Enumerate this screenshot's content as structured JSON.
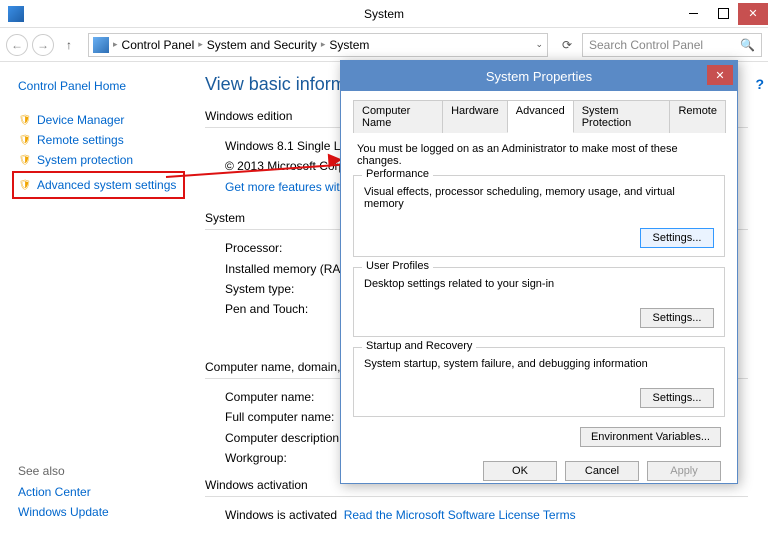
{
  "window": {
    "title": "System"
  },
  "breadcrumb": {
    "root": "Control Panel",
    "mid": "System and Security",
    "leaf": "System"
  },
  "search": {
    "placeholder": "Search Control Panel"
  },
  "sidebar": {
    "home": "Control Panel Home",
    "items": [
      "Device Manager",
      "Remote settings",
      "System protection",
      "Advanced system settings"
    ],
    "seeAlso": "See also",
    "alsoItems": [
      "Action Center",
      "Windows Update"
    ]
  },
  "page": {
    "heading": "View basic information about your computer",
    "ed_hdr": "Windows edition",
    "ed_line1": "Windows 8.1 Single Language",
    "ed_line2": "© 2013 Microsoft Corporation. All rights reserved.",
    "ed_link": "Get more features with a new edition of Windows",
    "sys_hdr": "System",
    "sys_rows": [
      "Processor:",
      "Installed memory (RAM):",
      "System type:",
      "Pen and Touch:"
    ],
    "dom_hdr": "Computer name, domain, and workgroup settings",
    "dom_rows": [
      "Computer name:",
      "Full computer name:",
      "Computer description:",
      "Workgroup:"
    ],
    "act_hdr": "Windows activation",
    "act_text": "Windows is activated",
    "act_link": "Read the Microsoft Software License Terms"
  },
  "dialog": {
    "title": "System Properties",
    "tabs": [
      "Computer Name",
      "Hardware",
      "Advanced",
      "System Protection",
      "Remote"
    ],
    "notice": "You must be logged on as an Administrator to make most of these changes.",
    "perf": {
      "legend": "Performance",
      "desc": "Visual effects, processor scheduling, memory usage, and virtual memory",
      "btn": "Settings..."
    },
    "prof": {
      "legend": "User Profiles",
      "desc": "Desktop settings related to your sign-in",
      "btn": "Settings..."
    },
    "start": {
      "legend": "Startup and Recovery",
      "desc": "System startup, system failure, and debugging information",
      "btn": "Settings..."
    },
    "env": "Environment Variables...",
    "ok": "OK",
    "cancel": "Cancel",
    "apply": "Apply"
  }
}
